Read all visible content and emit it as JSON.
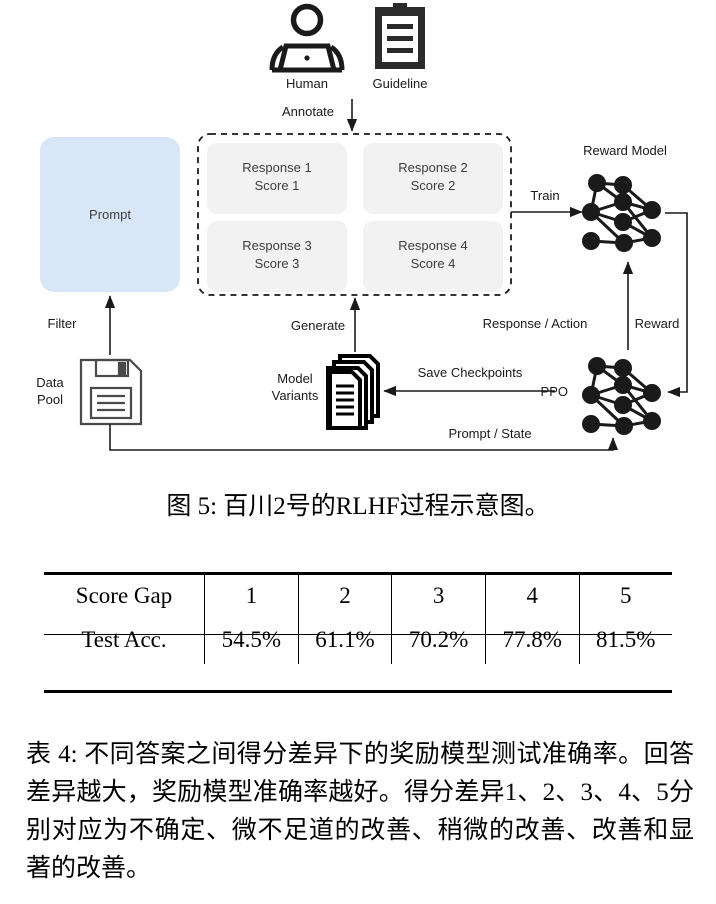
{
  "figure": {
    "caption": "图 5: 百川2号的RLHF过程示意图。",
    "icons": {
      "human_label": "Human",
      "guideline_label": "Guideline",
      "data_pool_label_line1": "Data",
      "data_pool_label_line2": "Pool",
      "model_variants_label_line1": "Model",
      "model_variants_label_line2": "Variants"
    },
    "nodes": {
      "prompt": "Prompt",
      "reward_model": "Reward Model",
      "ppo": "PPO"
    },
    "responses": [
      {
        "name": "Response 1",
        "score": "Score 1"
      },
      {
        "name": "Response 2",
        "score": "Score 2"
      },
      {
        "name": "Response 3",
        "score": "Score 3"
      },
      {
        "name": "Response 4",
        "score": "Score 4"
      }
    ],
    "edges": {
      "annotate": "Annotate",
      "filter": "Filter",
      "generate": "Generate",
      "train": "Train",
      "response_action": "Response / Action",
      "reward": "Reward",
      "save_checkpoints": "Save Checkpoints",
      "prompt_state": "Prompt / State"
    },
    "colors": {
      "prompt_fill": "#d8e6f7",
      "response_fill": "#f2f2f2",
      "stroke": "#1a1a1a"
    }
  },
  "table": {
    "caption": "表 4: 不同答案之间得分差异下的奖励模型测试准确率。回答差异越大，奖励模型准确率越好。得分差异1、2、3、4、5分别对应为不确定、微不足道的改善、稍微的改善、改善和显著的改善。",
    "row_header_label": "Score Gap",
    "row_data_label": "Test Acc.",
    "score_gaps": [
      "1",
      "2",
      "3",
      "4",
      "5"
    ],
    "test_acc": [
      "54.5%",
      "61.1%",
      "70.2%",
      "77.8%",
      "81.5%"
    ]
  },
  "chart_data": {
    "type": "table",
    "title": "Reward model test accuracy by score gap",
    "categories": [
      "1",
      "2",
      "3",
      "4",
      "5"
    ],
    "values": [
      54.5,
      61.1,
      70.2,
      77.8,
      81.5
    ],
    "xlabel": "Score Gap",
    "ylabel": "Test Acc. (%)",
    "ylim": [
      0,
      100
    ],
    "series": [
      {
        "name": "Test Acc.",
        "values": [
          54.5,
          61.1,
          70.2,
          77.8,
          81.5
        ]
      }
    ]
  }
}
